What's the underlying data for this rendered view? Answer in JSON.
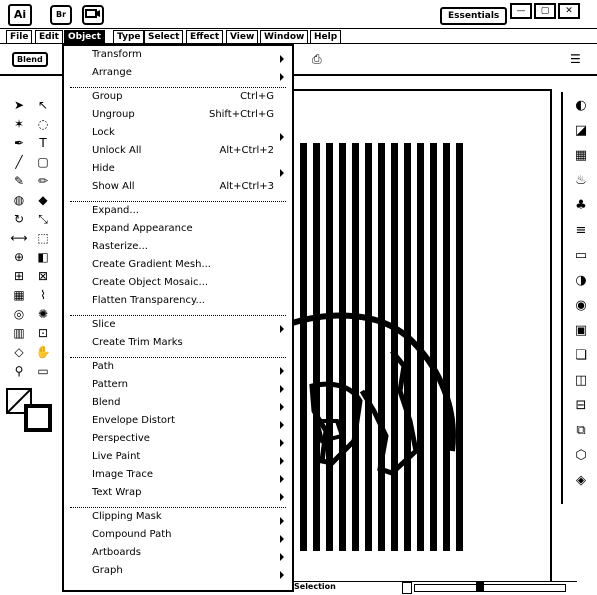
{
  "app": {
    "logo": "Ai",
    "workspace": "Essentials"
  },
  "title_icons": [
    {
      "label": "Br",
      "icon": "bridge-icon"
    },
    {
      "label": "",
      "icon": "camera-icon"
    }
  ],
  "window_controls": [
    "—",
    "▢",
    "✕"
  ],
  "menubar": [
    "File",
    "Edit",
    "Object",
    "Type",
    "Select",
    "Effect",
    "View",
    "Window",
    "Help"
  ],
  "active_menu": "Object",
  "control_bar": {
    "label": "Blend"
  },
  "status_bar": {
    "label": "Selection"
  },
  "object_menu": [
    {
      "label": "Transform",
      "shortcut": "",
      "submenu": true
    },
    {
      "label": "Arrange",
      "shortcut": "",
      "submenu": true
    },
    {
      "sep": true
    },
    {
      "label": "Group",
      "shortcut": "Ctrl+G",
      "submenu": false
    },
    {
      "label": "Ungroup",
      "shortcut": "Shift+Ctrl+G",
      "submenu": false
    },
    {
      "label": "Lock",
      "shortcut": "",
      "submenu": true
    },
    {
      "label": "Unlock All",
      "shortcut": "Alt+Ctrl+2",
      "submenu": false
    },
    {
      "label": "Hide",
      "shortcut": "",
      "submenu": true
    },
    {
      "label": "Show All",
      "shortcut": "Alt+Ctrl+3",
      "submenu": false
    },
    {
      "sep": true
    },
    {
      "label": "Expand...",
      "shortcut": "",
      "submenu": false
    },
    {
      "label": "Expand Appearance",
      "shortcut": "",
      "submenu": false
    },
    {
      "label": "Rasterize...",
      "shortcut": "",
      "submenu": false
    },
    {
      "label": "Create Gradient Mesh...",
      "shortcut": "",
      "submenu": false
    },
    {
      "label": "Create Object Mosaic...",
      "shortcut": "",
      "submenu": false
    },
    {
      "label": "Flatten Transparency...",
      "shortcut": "",
      "submenu": false
    },
    {
      "sep": true
    },
    {
      "label": "Slice",
      "shortcut": "",
      "submenu": true
    },
    {
      "label": "Create Trim Marks",
      "shortcut": "",
      "submenu": false
    },
    {
      "sep": true
    },
    {
      "label": "Path",
      "shortcut": "",
      "submenu": true
    },
    {
      "label": "Pattern",
      "shortcut": "",
      "submenu": true
    },
    {
      "label": "Blend",
      "shortcut": "",
      "submenu": true
    },
    {
      "label": "Envelope Distort",
      "shortcut": "",
      "submenu": true
    },
    {
      "label": "Perspective",
      "shortcut": "",
      "submenu": true
    },
    {
      "label": "Live Paint",
      "shortcut": "",
      "submenu": true
    },
    {
      "label": "Image Trace",
      "shortcut": "",
      "submenu": true
    },
    {
      "label": "Text Wrap",
      "shortcut": "",
      "submenu": true
    },
    {
      "sep": true
    },
    {
      "label": "Clipping Mask",
      "shortcut": "",
      "submenu": true
    },
    {
      "label": "Compound Path",
      "shortcut": "",
      "submenu": true
    },
    {
      "label": "Artboards",
      "shortcut": "",
      "submenu": true
    },
    {
      "label": "Graph",
      "shortcut": "",
      "submenu": true
    }
  ],
  "tools": [
    {
      "name": "selection-tool-icon",
      "glyph": "➤"
    },
    {
      "name": "direct-selection-tool-icon",
      "glyph": "↖"
    },
    {
      "name": "magic-wand-tool-icon",
      "glyph": "✶"
    },
    {
      "name": "lasso-tool-icon",
      "glyph": "◌"
    },
    {
      "name": "pen-tool-icon",
      "glyph": "✒"
    },
    {
      "name": "type-tool-icon",
      "glyph": "T"
    },
    {
      "name": "line-tool-icon",
      "glyph": "╱"
    },
    {
      "name": "rectangle-tool-icon",
      "glyph": "▢"
    },
    {
      "name": "paintbrush-tool-icon",
      "glyph": "✎"
    },
    {
      "name": "pencil-tool-icon",
      "glyph": "✏"
    },
    {
      "name": "blob-brush-tool-icon",
      "glyph": "◍"
    },
    {
      "name": "eraser-tool-icon",
      "glyph": "◆"
    },
    {
      "name": "rotate-tool-icon",
      "glyph": "↻"
    },
    {
      "name": "scale-tool-icon",
      "glyph": "⤡"
    },
    {
      "name": "width-tool-icon",
      "glyph": "⟷"
    },
    {
      "name": "free-transform-tool-icon",
      "glyph": "⬚"
    },
    {
      "name": "shape-builder-tool-icon",
      "glyph": "⊕"
    },
    {
      "name": "live-paint-tool-icon",
      "glyph": "◧"
    },
    {
      "name": "perspective-grid-tool-icon",
      "glyph": "⊞"
    },
    {
      "name": "mesh-tool-icon",
      "glyph": "⊠"
    },
    {
      "name": "gradient-tool-icon",
      "glyph": "▦"
    },
    {
      "name": "eyedropper-tool-icon",
      "glyph": "⌇"
    },
    {
      "name": "blend-tool-icon",
      "glyph": "◎"
    },
    {
      "name": "symbol-sprayer-tool-icon",
      "glyph": "✺"
    },
    {
      "name": "column-graph-tool-icon",
      "glyph": "▥"
    },
    {
      "name": "artboard-tool-icon",
      "glyph": "⊡"
    },
    {
      "name": "slice-tool-icon",
      "glyph": "◇"
    },
    {
      "name": "hand-tool-icon",
      "glyph": "✋"
    },
    {
      "name": "zoom-tool-icon",
      "glyph": "⚲"
    },
    {
      "name": "screen-mode-icon",
      "glyph": "▭"
    }
  ],
  "panel_icons": [
    {
      "name": "color-panel-icon",
      "glyph": "◐"
    },
    {
      "name": "color-guide-panel-icon",
      "glyph": "◪"
    },
    {
      "name": "swatches-panel-icon",
      "glyph": "▦"
    },
    {
      "name": "brushes-panel-icon",
      "glyph": "♨"
    },
    {
      "name": "symbols-panel-icon",
      "glyph": "♣"
    },
    {
      "name": "stroke-panel-icon",
      "glyph": "≡"
    },
    {
      "name": "gradient-panel-icon",
      "glyph": "▭"
    },
    {
      "name": "transparency-panel-icon",
      "glyph": "◑"
    },
    {
      "name": "appearance-panel-icon",
      "glyph": "◉"
    },
    {
      "name": "graphic-styles-panel-icon",
      "glyph": "▣"
    },
    {
      "name": "layers-panel-icon",
      "glyph": "❏"
    },
    {
      "name": "artboards-panel-icon",
      "glyph": "◫"
    },
    {
      "name": "align-panel-icon",
      "glyph": "⊟"
    },
    {
      "name": "pathfinder-panel-icon",
      "glyph": "⧉"
    },
    {
      "name": "transform-panel-icon",
      "glyph": "⬡"
    },
    {
      "name": "navigator-panel-icon",
      "glyph": "◈"
    }
  ]
}
